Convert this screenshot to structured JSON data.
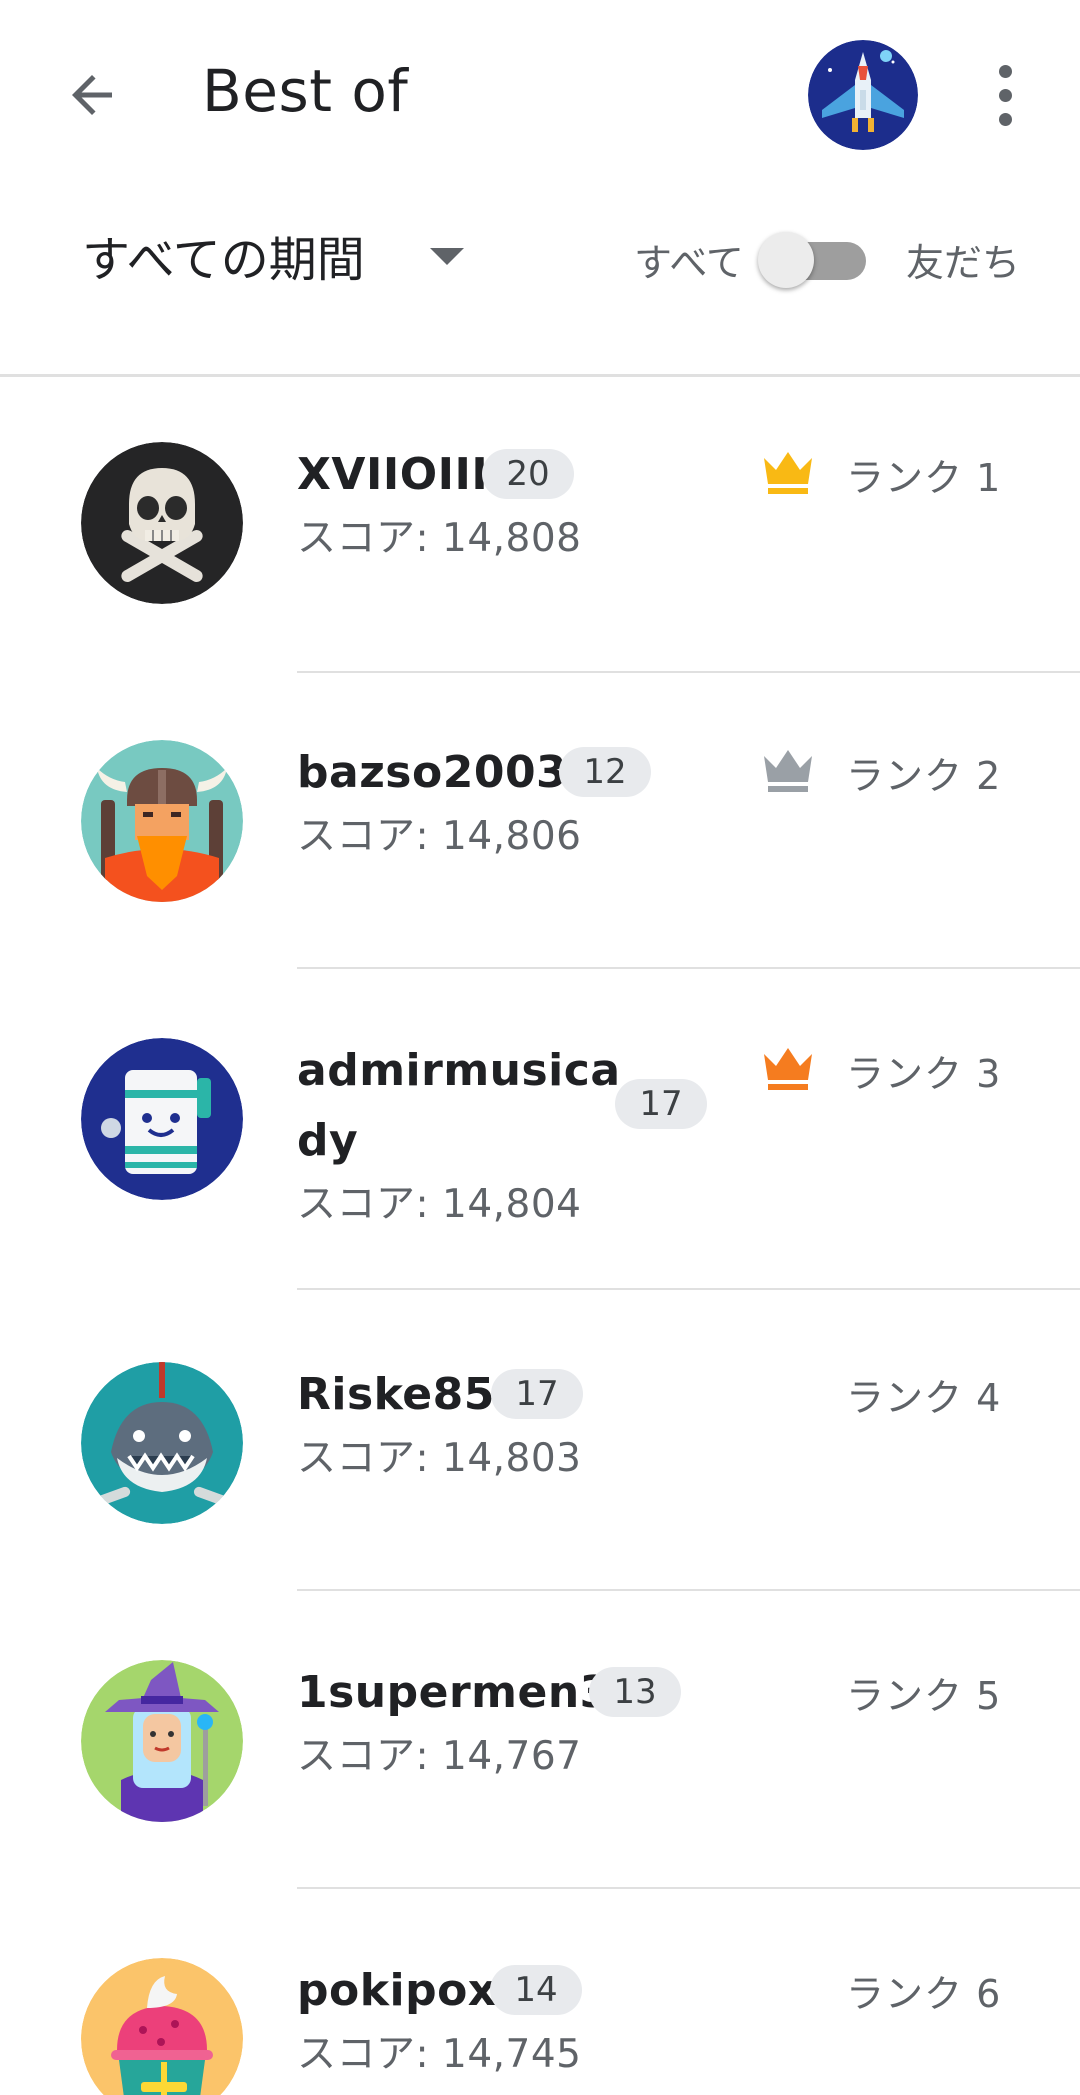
{
  "header": {
    "title": "Best of",
    "back_icon": "arrow-back-icon",
    "more_icon": "more-vert-icon"
  },
  "filters": {
    "period": "すべての期間",
    "toggle_left": "すべて",
    "toggle_right": "友だち",
    "toggle_on": false
  },
  "players": [
    {
      "name": "XVIIOIII",
      "level": "20",
      "score": "スコア: 14,808",
      "rank": "ランク 1",
      "crown": "gold-crown-icon"
    },
    {
      "name": "bazso2003",
      "level": "12",
      "score": "スコア: 14,806",
      "rank": "ランク 2",
      "crown": "silver-crown-icon"
    },
    {
      "name_line1": "admirmusica",
      "name_line2": "dy",
      "level": "17",
      "score": "スコア: 14,804",
      "rank": "ランク 3",
      "crown": "bronze-crown-icon"
    },
    {
      "name": "Riske85",
      "level": "17",
      "score": "スコア: 14,803",
      "rank": "ランク 4"
    },
    {
      "name": "1supermen3",
      "level": "13",
      "score": "スコア: 14,767",
      "rank": "ランク 5"
    },
    {
      "name": "pokipox",
      "level": "14",
      "score": "スコア: 14,745",
      "rank": "ランク 6"
    }
  ],
  "colors": {
    "gold": "#F9B914",
    "silver": "#9AA0A6",
    "bronze": "#F57C1F"
  }
}
